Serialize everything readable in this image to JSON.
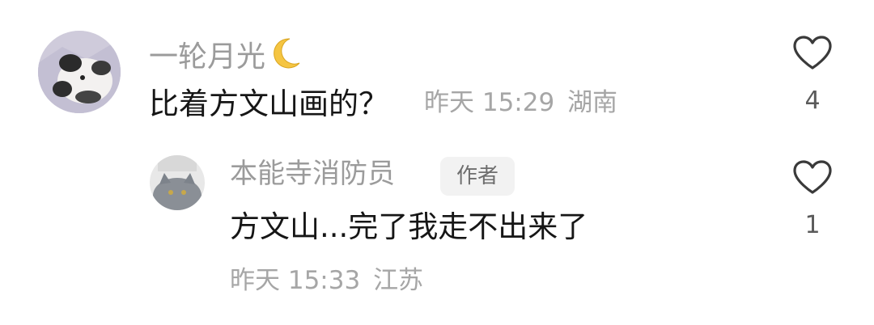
{
  "comments": [
    {
      "username": "一轮月光",
      "username_emoji": "crescent-moon-icon",
      "text": "比着方文山画的？",
      "time": "昨天 15:29",
      "location": "湖南",
      "likes": "4"
    },
    {
      "username": "本能寺消防员",
      "author_badge": "作者",
      "text": "方文山...完了我走不出来了",
      "time": "昨天 15:33",
      "location": "江苏",
      "likes": "1"
    }
  ],
  "colors": {
    "username": "#9b9b9b",
    "text": "#161616",
    "meta": "#a6a6a6",
    "like_count": "#5a5a5a",
    "badge_bg": "#f2f2f2",
    "moon": "#f5c542"
  }
}
